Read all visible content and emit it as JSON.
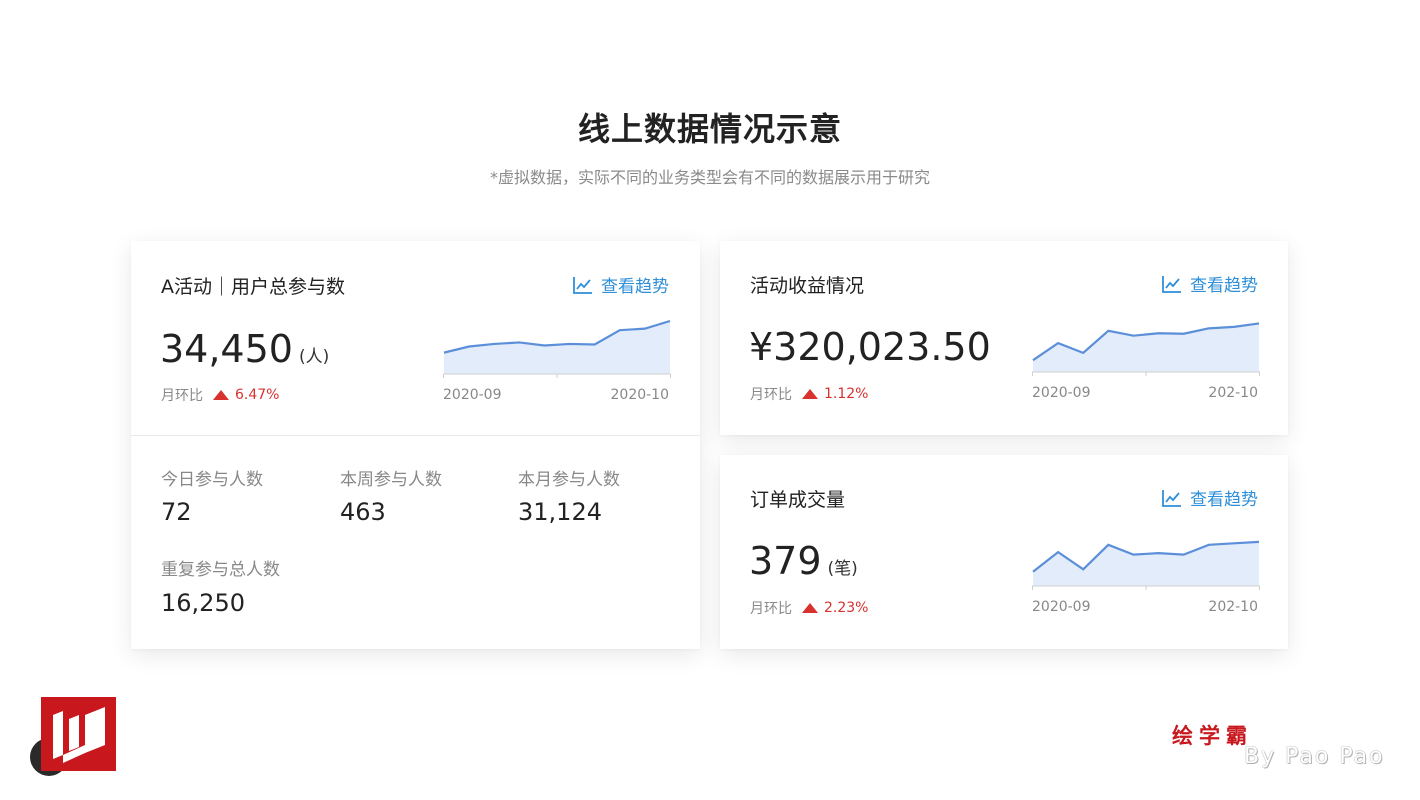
{
  "header": {
    "title": "线上数据情况示意",
    "subtitle": "*虚拟数据，实际不同的业务类型会有不同的数据展示用于研究"
  },
  "card_a": {
    "title": "A活动｜用户总参与数",
    "trend_label": "查看趋势",
    "value": "34,450",
    "unit": "(人)",
    "mom_label": "月环比",
    "mom_pct": "6.47%",
    "x_start": "2020-09",
    "x_end": "2020-10",
    "spark": [
      0.38,
      0.5,
      0.55,
      0.58,
      0.52,
      0.55,
      0.54,
      0.82,
      0.85,
      1.0
    ],
    "stats": [
      {
        "label": "今日参与人数",
        "value": "72"
      },
      {
        "label": "本周参与人数",
        "value": "463"
      },
      {
        "label": "本月参与人数",
        "value": "31,124"
      },
      {
        "label": "重复参与总人数",
        "value": "16,250"
      }
    ]
  },
  "card_b": {
    "title": "活动收益情况",
    "trend_label": "查看趋势",
    "value": "¥320,023.50",
    "mom_label": "月环比",
    "mom_pct": "1.12%",
    "x_start": "2020-09",
    "x_end": "202-10",
    "spark": [
      0.2,
      0.55,
      0.35,
      0.8,
      0.7,
      0.75,
      0.74,
      0.85,
      0.88,
      0.95
    ]
  },
  "card_c": {
    "title": "订单成交量",
    "trend_label": "查看趋势",
    "value": "379",
    "unit": "(笔)",
    "mom_label": "月环比",
    "mom_pct": "2.23%",
    "x_start": "2020-09",
    "x_end": "202-10",
    "spark": [
      0.25,
      0.65,
      0.3,
      0.8,
      0.6,
      0.63,
      0.6,
      0.8,
      0.83,
      0.86
    ]
  },
  "footer": {
    "brand": "绘学霸",
    "byline": "By Pao Pao"
  },
  "colors": {
    "accent": "#2f8fd8",
    "up": "#d8322f",
    "line": "#5b8fd9",
    "area": "#e3ecfa",
    "logo": "#c8181e"
  }
}
